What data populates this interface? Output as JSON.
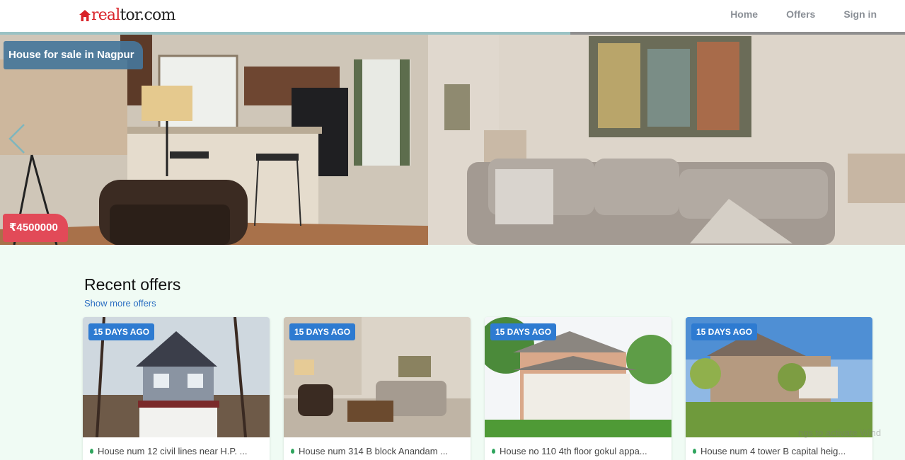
{
  "header": {
    "logo_text_red": "real",
    "logo_text_dark": "tor.com",
    "nav": [
      {
        "label": "Home"
      },
      {
        "label": "Offers"
      },
      {
        "label": "Sign in"
      }
    ]
  },
  "hero": {
    "title": "House for sale in Nagpur",
    "price": "₹4500000",
    "slide_progress": 0.63
  },
  "recent": {
    "title": "Recent offers",
    "show_more": "Show more offers",
    "cards": [
      {
        "badge": "15 DAYS AGO",
        "address": "House num 12 civil lines near H.P. ..."
      },
      {
        "badge": "15 DAYS AGO",
        "address": "House num 314 B block Anandam ..."
      },
      {
        "badge": "15 DAYS AGO",
        "address": "House no 110 4th floor gokul appa..."
      },
      {
        "badge": "15 DAYS AGO",
        "address": "House num 4 tower B capital heig..."
      }
    ]
  },
  "watermark": "ngs to activate Wind",
  "colors": {
    "brand_red": "#d92228",
    "badge_blue": "#2e7bd1",
    "price_red": "#e24a58",
    "link_blue": "#2c6fc2",
    "page_bg": "#f0fbf4"
  }
}
